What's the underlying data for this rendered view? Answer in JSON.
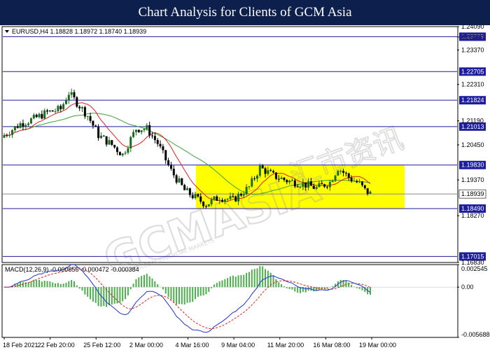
{
  "banner": {
    "title": "Chart Analysis for Clients of GCM Asia"
  },
  "colors": {
    "banner_bg": "#0d1f4d",
    "level_line": "#1d1d9e",
    "level_label_bg": "#1d1d9e",
    "zone_fill": "#ffff00",
    "bull": "#1a6b1a",
    "bear": "#000000",
    "ma_fast": "#e02020",
    "ma_slow": "#3ba53b",
    "macd_line": "#2233cc",
    "signal_line": "#e02020",
    "macd_hist": "#4cae4c"
  },
  "chart_data": [
    {
      "type": "candlestick",
      "symbol_info": "EURUSD,H4  1.18828 1.18972 1.18740 1.18939",
      "ylim": [
        1.1683,
        1.2409
      ],
      "y_ticks": [
        "1.24090",
        "1.23770",
        "1.23370",
        "1.22705",
        "1.22310",
        "1.21824",
        "1.21190",
        "1.21013",
        "1.20450",
        "1.19830",
        "1.19370",
        "1.18939",
        "1.18490",
        "1.18270",
        "1.17015",
        "1.16830"
      ],
      "x_ticks": [
        "18 Feb 2021",
        "22 Feb 20:00",
        "25 Feb 12:00",
        "2 Mar 00:00",
        "4 Mar 16:00",
        "9 Mar 04:00",
        "11 Mar 20:00",
        "16 Mar 08:00",
        "19 Mar 00:00"
      ],
      "levels": [
        {
          "value": 1.23779,
          "label": "1.23779"
        },
        {
          "value": 1.22705,
          "label": "1.22705"
        },
        {
          "value": 1.21824,
          "label": "1.21824"
        },
        {
          "value": 1.21013,
          "label": "1.21013"
        },
        {
          "value": 1.1983,
          "label": "1.19830"
        },
        {
          "value": 1.1849,
          "label": "1.18490"
        },
        {
          "value": 1.17015,
          "label": "1.17015"
        }
      ],
      "current_price": {
        "value": 1.18939,
        "label": "1.18939"
      },
      "zone": {
        "top": 1.1983,
        "bottom": 1.1849,
        "start_index": 72
      },
      "close_anchors": [
        [
          0,
          1.2075
        ],
        [
          6,
          1.211
        ],
        [
          11,
          1.2125
        ],
        [
          16,
          1.2145
        ],
        [
          21,
          1.2155
        ],
        [
          24,
          1.2205
        ],
        [
          27,
          1.2175
        ],
        [
          31,
          1.2135
        ],
        [
          35,
          1.2075
        ],
        [
          40,
          1.2045
        ],
        [
          44,
          1.2015
        ],
        [
          49,
          1.2095
        ],
        [
          53,
          1.2095
        ],
        [
          57,
          1.205
        ],
        [
          62,
          1.1965
        ],
        [
          67,
          1.1905
        ],
        [
          70,
          1.1888
        ],
        [
          75,
          1.1862
        ],
        [
          80,
          1.1885
        ],
        [
          85,
          1.1875
        ],
        [
          91,
          1.1915
        ],
        [
          95,
          1.1975
        ],
        [
          100,
          1.195
        ],
        [
          105,
          1.1935
        ],
        [
          111,
          1.1925
        ],
        [
          116,
          1.1912
        ],
        [
          121,
          1.193
        ],
        [
          124,
          1.1975
        ],
        [
          128,
          1.1945
        ],
        [
          132,
          1.1925
        ],
        [
          134,
          1.1905
        ],
        [
          136,
          1.1895
        ]
      ],
      "candle_count": 137
    },
    {
      "type": "macd",
      "title": "MACD(12,26,9) -0.000856 -0.000472 -0.000384",
      "ylim": [
        -0.005688,
        0.002545
      ],
      "y_ticks": [
        "0.002545",
        "0.00",
        "-0.005688"
      ]
    }
  ],
  "watermark": {
    "text": "GCMASIA",
    "chinese": "汇市资讯",
    "tagline": "GLOBAL FINANCIAL MARKETS"
  }
}
